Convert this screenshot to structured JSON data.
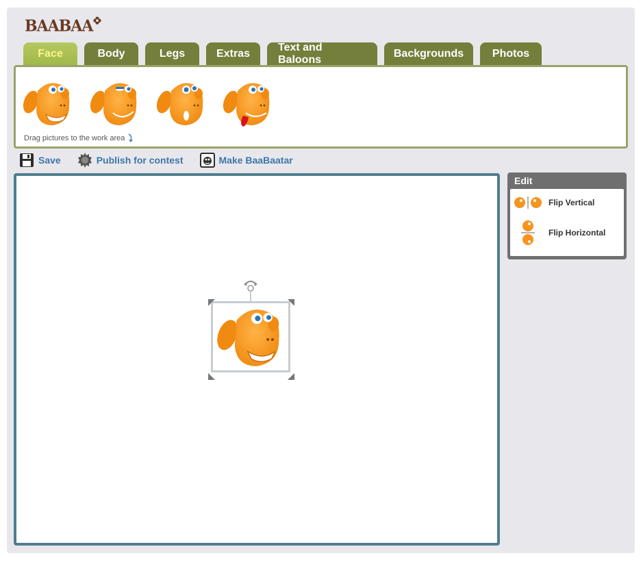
{
  "logo": {
    "text": "BAABAA"
  },
  "tabs": [
    {
      "label": "Face",
      "active": true
    },
    {
      "label": "Body",
      "active": false
    },
    {
      "label": "Legs",
      "active": false
    },
    {
      "label": "Extras",
      "active": false
    },
    {
      "label": "Text and Baloons",
      "active": false
    },
    {
      "label": "Backgrounds",
      "active": false
    },
    {
      "label": "Photos",
      "active": false
    }
  ],
  "palette": {
    "hint": "Drag pictures to the work area",
    "items": [
      "face-grin",
      "face-wink",
      "face-surprised",
      "face-tongue"
    ]
  },
  "toolbar": {
    "save_label": "Save",
    "publish_label": "Publish for contest",
    "make_label": "Make BaaBaatar"
  },
  "edit": {
    "title": "Edit",
    "flip_vertical_label": "Flip Vertical",
    "flip_horizontal_label": "Flip Horizontal"
  },
  "colors": {
    "tab_bg": "#737f3b",
    "tab_active_bg": "#a9bf52",
    "tab_active_text": "#f9f58a",
    "palette_border": "#9ba269",
    "workarea_border": "#4f7d8f",
    "link": "#3d76a8",
    "sheep_orange": "#f7941d"
  }
}
